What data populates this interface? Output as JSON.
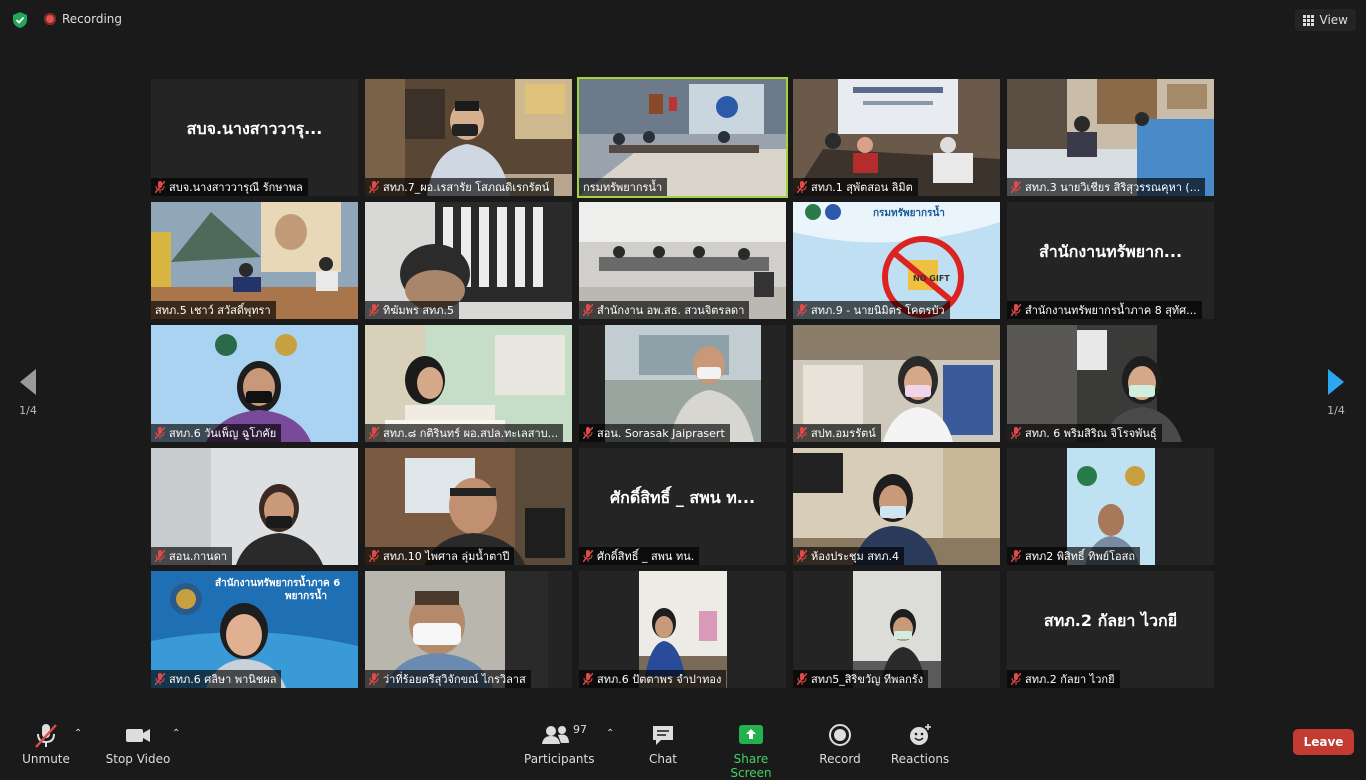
{
  "top": {
    "recording_label": "Recording",
    "view_label": "View"
  },
  "pager": {
    "left": "1/4",
    "right": "1/4"
  },
  "tiles": [
    {
      "name": "สบจ.นางสาววารุณี รักษาพล",
      "big": "สบจ.นางสาววารุ...",
      "muted": true
    },
    {
      "name": "สทภ.7_ผอ.เรสารัย โสภณดิเรกรัตน์",
      "muted": true
    },
    {
      "name": "กรมทรัพยากรน้ำ",
      "muted": false
    },
    {
      "name": "สทภ.1 สุพัตสอน ลิมิต",
      "muted": true
    },
    {
      "name": "สทภ.3 นายวิเชียร สิริสุวรรณคุหา (...",
      "muted": true
    },
    {
      "name": "สทภ.5 เชาว์ สวัสดิ์พุทรา",
      "muted": false
    },
    {
      "name": "ทิฆัมพร สทภ.5",
      "muted": true
    },
    {
      "name": "สำนักงาน อพ.สธ. สวนจิตรลดา",
      "muted": true
    },
    {
      "name": "สทภ.9 - นายนิมิตร โคตรบัว",
      "muted": true
    },
    {
      "name": "สำนักงานทรัพยากรน้ำภาค 8 สุทัศ...",
      "big": "สำนักงานทรัพยาก...",
      "muted": true
    },
    {
      "name": "สทภ.6 วันเพ็ญ ฉูโภคัย",
      "muted": true
    },
    {
      "name": "สทภ.๘ กติรินทร์ ผอ.สปล.ทะเลสาบ...",
      "muted": true
    },
    {
      "name": "สอน. Sorasak Jaiprasert",
      "muted": true
    },
    {
      "name": "สปท.อมรรัตน์",
      "muted": true
    },
    {
      "name": "สทภ. 6 พริมสิริณ จิโรจพันธุ์",
      "muted": true
    },
    {
      "name": "สอน.กานดา",
      "muted": true
    },
    {
      "name": "สทภ.10 ไพศาล ลุ่มน้ำตาปี",
      "muted": true
    },
    {
      "name": "ศักดิ์สิทธิ์ _ สพน ทน.",
      "big": "ศักดิ์สิทธิ์ _ สพน ท...",
      "muted": true
    },
    {
      "name": "ห้องประชุม สทภ.4",
      "muted": true
    },
    {
      "name": "สทภ2 พิสิทธิ์ ทิพย์โอสถ",
      "muted": true
    },
    {
      "name": "สทภ.6 ศลิษา พานิชผล",
      "muted": true
    },
    {
      "name": "ว่าที่ร้อยตรีสุวิจักขณ์ ไกรวิลาส",
      "muted": true
    },
    {
      "name": "สทภ.6 ปัตตาพร จำปาทอง",
      "muted": true
    },
    {
      "name": "สทภ5_สิริขวัญ ทีพลกรัง",
      "muted": true
    },
    {
      "name": "สทภ.2 กัลยา ไวกยี",
      "big": "สทภ.2 กัลยา ไวกยี",
      "muted": true
    }
  ],
  "banner_text": {
    "line1": "สำนักงานทรัพยากรน้ำภาค 6",
    "line2": "พยากรน้ำ"
  },
  "tile9_header": "กรมทรัพยากรน้ำ",
  "tile9_badge": "NO GIFT",
  "toolbar": {
    "unmute": "Unmute",
    "stop_video": "Stop Video",
    "participants": "Participants",
    "participants_count": "97",
    "chat": "Chat",
    "share_screen": "Share Screen",
    "record": "Record",
    "reactions": "Reactions",
    "leave": "Leave"
  },
  "colors": {
    "active_speaker": "#a2d33c",
    "share": "#3fd363",
    "leave": "#c43b32",
    "mic_muted": "#e24a4a"
  }
}
